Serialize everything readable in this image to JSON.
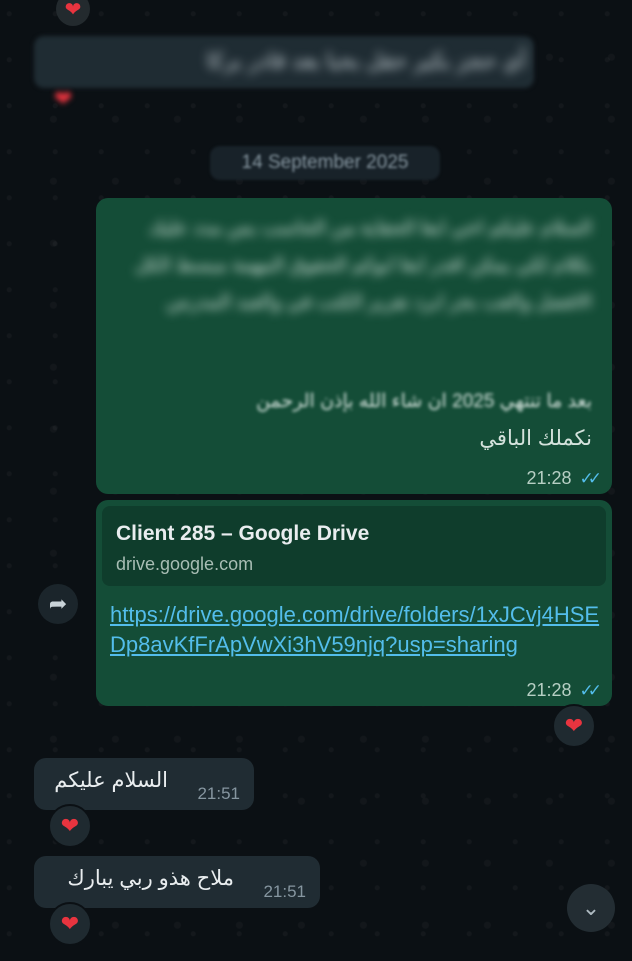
{
  "date_separator": "14 September 2025",
  "messages": [
    {
      "id": "msg1",
      "direction": "outgoing",
      "blurred_text": "السلام عليكم اخي ابغا الحقاية من الحاسب بس مدد عليك بكلام لكي يمكن اقدر ابغا ابوكم الحقوق المهمة مبسط الكل الافضل والعب بحر ابرد تقرير الكتب في والعبد المدرس",
      "visible_line_1": "بعد ما تنتهي 2025 ان شاء الله بإذن الرحمن",
      "visible_line_2": "نكملك الباقي",
      "time": "21:28",
      "ticks": "✓✓"
    },
    {
      "id": "msg2",
      "direction": "outgoing",
      "preview_title": "Client 285 – Google Drive",
      "preview_domain": "drive.google.com",
      "link": "https://drive.google.com/drive/folders/1xJCvj4HSEDp8avKfFrApVwXi3hV59njq?usp=sharing",
      "time": "21:28",
      "ticks": "✓✓",
      "reaction": "❤"
    },
    {
      "id": "msg3",
      "direction": "incoming",
      "text": "السلام عليكم",
      "time": "21:51",
      "reaction": "❤"
    },
    {
      "id": "msg4",
      "direction": "incoming",
      "text": "ملاح هذو ربي يبارك",
      "time": "21:51",
      "reaction": "❤"
    }
  ],
  "icons": {
    "forward": "forward-icon",
    "scroll": "double-chevron-down-icon",
    "heart": "heart-icon"
  },
  "colors": {
    "outgoing_bubble": "#144d37",
    "incoming_bubble": "#202c33",
    "link": "#53bdeb",
    "read_ticks": "#53bdeb",
    "heart": "#e8343f"
  }
}
